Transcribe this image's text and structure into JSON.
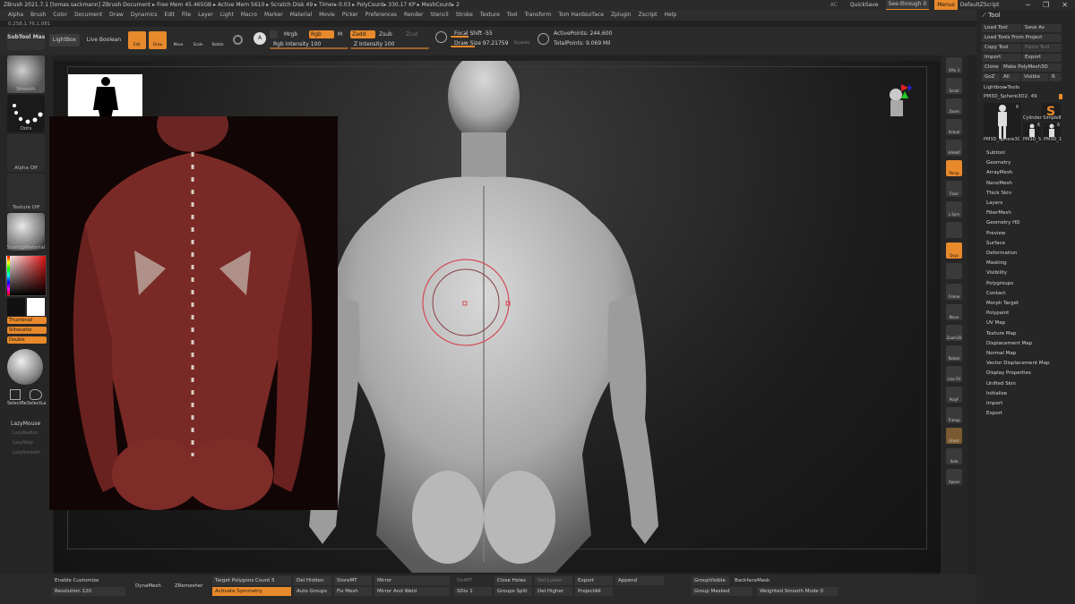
{
  "titlebar": {
    "text": "ZBrush 2021.7.1 [tomas sackmann]   ZBrush Document     ▸ Free Mem 45.465GB ▸ Active Mem 5610 ▸ Scratch Disk 49 ▸ Timer▸ 0.03 ▸ PolyCount▸ 330.17 KP ▸ MeshCount▸ 2",
    "ac": "AC",
    "quicksave": "QuickSave",
    "see_through": "See-through  0",
    "menus": "Menus",
    "default_zscript": "DefaultZScript"
  },
  "menubar": [
    "Alpha",
    "Brush",
    "Color",
    "Document",
    "Draw",
    "Dynamics",
    "Edit",
    "File",
    "Layer",
    "Light",
    "Macro",
    "Marker",
    "Material",
    "Movie",
    "Picker",
    "Preferences",
    "Render",
    "Stencil",
    "Stroke",
    "Texture",
    "Tool",
    "Transform",
    "Tom Hardsurface",
    "Zplugin",
    "Zscript",
    "Help"
  ],
  "infoline": "0.258,1.76,1.081",
  "topbar": {
    "subtool_master": "SubTool Master",
    "lightbox": "LightBox",
    "live_boolean": "Live Boolean",
    "edit": "Edit",
    "draw": "Draw",
    "move": "Move",
    "scale": "Scale",
    "rotate": "Rotate",
    "a": "A",
    "mrgb": "Mrgb",
    "rgb": "Rgb",
    "m": "M",
    "rgb_intensity": "Rgb Intensity 100",
    "zadd": "Zadd",
    "zsub": "Zsub",
    "zcut": "Zcut",
    "z_intensity": "Z Intensity 100",
    "focal_shift": "Focal Shift -55",
    "draw_size": "Draw Size 97.21759",
    "dynamic": "Dynamic",
    "active_points": "ActivePoints: 244,600",
    "total_points": "TotalPoints: 9.069 Mil"
  },
  "leftshelf": {
    "brush": "Smooth",
    "stroke": "Dots",
    "alpha": "Alpha Off",
    "texture": "Texture Off",
    "material": "StartupMaterial",
    "thumbnail": "Thumbnail",
    "silhouette": "Silhouette",
    "double": "Double",
    "selectrect": "SelectRe",
    "selectlasso": "SelectLa",
    "lazymouse": "LazyMouse",
    "lazyradius": "LazyRadius",
    "lazystep": "LazyStep",
    "lazysmooth": "LazySmooth"
  },
  "rightshelf": [
    "SPix 3",
    "Scroll",
    "Zoom",
    "Actual",
    "AAHalf",
    "Persp",
    "Floor",
    "L.Sym",
    "",
    "Qxyz",
    "",
    "Frame",
    "Move",
    "Zoom3D",
    "Rotate",
    "Line Fill",
    "PolyF",
    "Transp",
    "Ghost",
    "Solo",
    "Xpose"
  ],
  "toolpanel": {
    "title": "Tool",
    "load_tool": "Load Tool",
    "save_as": "Save As",
    "load_from_project": "Load Tools From Project",
    "copy_tool": "Copy Tool",
    "paste_tool": "Paste Tool",
    "import": "Import",
    "export": "Export",
    "clone": "Clone",
    "make_polymesh": "Make PolyMesh3D",
    "goz": "GoZ",
    "all": "All",
    "visible": "Visible",
    "r": "R",
    "lightbox_tools": "Lightbox▸Tools",
    "current_tool": "PM3D_Sphere3D2. 49",
    "thumb_labels": [
      "PM3D_Sphere3C",
      "Cylinder Simple8",
      "PM3D_S",
      "PM3D_1"
    ],
    "thumb_nums": [
      "6",
      "6",
      "6"
    ],
    "menu": [
      "Subtool",
      "Geometry",
      "ArrayMesh",
      "NanoMesh",
      "Thick Skin",
      "Layers",
      "FiberMesh",
      "Geometry HD",
      "Preview",
      "Surface",
      "Deformation",
      "Masking",
      "Visibility",
      "Polygroups",
      "Contact",
      "Morph Target",
      "Polypaint",
      "UV Map",
      "Texture Map",
      "Displacement Map",
      "Normal Map",
      "Vector Displacement Map",
      "Display Properties",
      "Unified Skin",
      "Initialize",
      "Import",
      "Export"
    ]
  },
  "bottombar": {
    "enable_customize": "Enable Customize",
    "resolution": "Resolution 120",
    "dynamesh": "DynaMesh",
    "zremesher": "ZRemesher",
    "target_poly": "Target Polygons Count 5",
    "activate_symmetry": "Activate Symmetry",
    "del_hidden": "Del Hidden",
    "auto_groups": "Auto Groups",
    "storemt": "StoreMT",
    "fix_mesh": "Fix Mesh",
    "mirror": "Mirror",
    "mirror_weld": "Mirror And Weld",
    "delmt": "DelMT",
    "sdiv": "SDiv 1",
    "close_holes": "Close Holes",
    "groups_split": "Groups Split",
    "del_lower": "Del Lower",
    "del_higher": "Del Higher",
    "export": "Export",
    "projectall": "ProjectAll",
    "append": "Append",
    "groupvisible": "GroupVisible",
    "backfacemask": "BackfaceMask",
    "group_masked": "Group Masked",
    "weighted_smooth": "Weighted Smooth Mode 0"
  },
  "colors": {
    "accent": "#e8892b",
    "panel": "#262626",
    "muscle": "#7a2a26"
  }
}
